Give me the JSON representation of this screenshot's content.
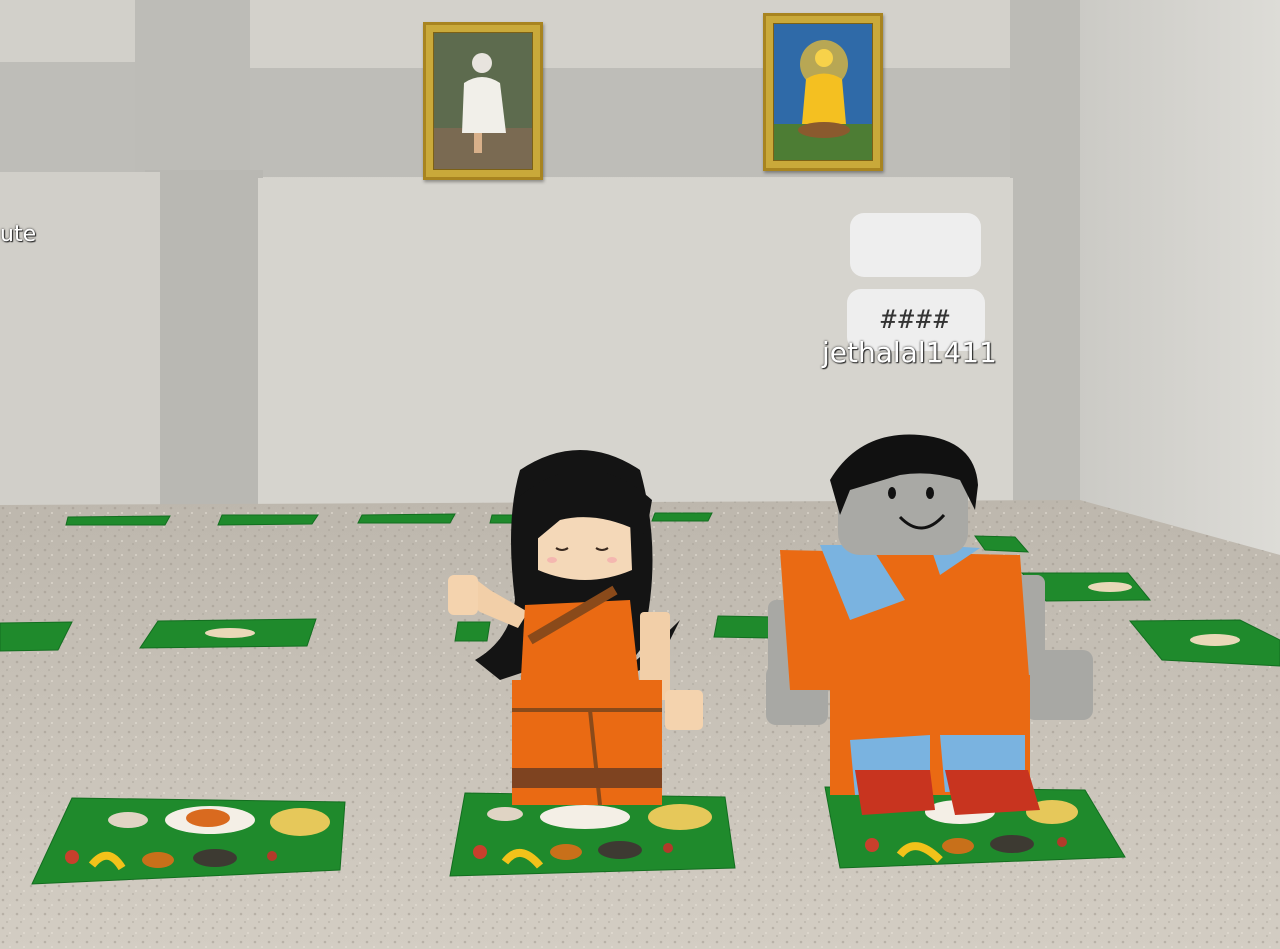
{
  "players": [
    {
      "username": "jethalal1411",
      "chat_bubble_top": "",
      "chat_bubble_bottom": "####"
    }
  ],
  "offscreen_nametag_fragment": "ute",
  "wall_pictures": [
    "saint-portrait-white-robe",
    "saint-portrait-golden-robe"
  ],
  "colors": {
    "wall": "#d4d2cc",
    "pillar": "#bdbcb7",
    "floor": "#c8c2b8",
    "leaf": "#1f8a2c",
    "saffron": "#ea6a13",
    "frame_gold": "#c9a93a"
  }
}
